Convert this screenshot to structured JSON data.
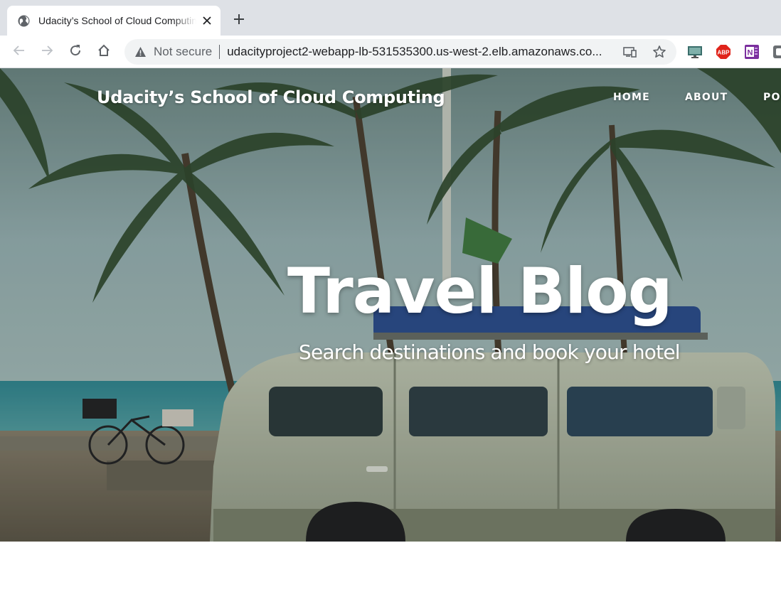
{
  "browser": {
    "tab": {
      "title": "Udacity’s School of Cloud Computing",
      "favicon": "globe-icon",
      "close_icon": "close-icon"
    },
    "new_tab_icon": "plus-icon",
    "nav": {
      "back_icon": "back-arrow-icon",
      "forward_icon": "forward-arrow-icon",
      "reload_icon": "reload-icon",
      "home_icon": "home-icon"
    },
    "omnibox": {
      "security_icon": "warning-icon",
      "security_label": "Not secure",
      "url": "udacityproject2-webapp-lb-531535300.us-west-2.elb.amazonaws.co...",
      "install_icon": "install-app-icon",
      "bookmark_icon": "star-icon"
    },
    "extensions": [
      "monitor-icon",
      "adblock-plus-icon",
      "onenote-icon",
      "extension-icon"
    ],
    "colors": {
      "tabstrip": "#dee1e6",
      "omnibox": "#f1f3f4",
      "abp": "#e0241b",
      "onenote": "#7b2f9e"
    }
  },
  "site": {
    "brand": "Udacity’s School of Cloud Computing",
    "nav": [
      {
        "label": "HOME"
      },
      {
        "label": "ABOUT"
      },
      {
        "label": "POSTS"
      }
    ],
    "hero": {
      "title": "Travel Blog",
      "subtitle": "Search destinations and book your hotel",
      "image": "beach-palm-trees-and-van-photo"
    }
  }
}
